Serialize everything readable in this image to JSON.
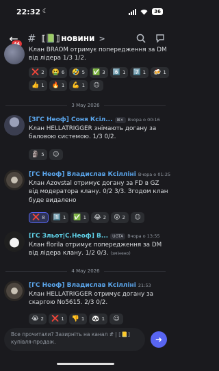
{
  "status": {
    "time": "22:32",
    "battery": "36"
  },
  "header": {
    "badge": "44",
    "hash": "#",
    "channel_prefix": "⟦📗⟧",
    "channel_name": "новини",
    "chevron": ">"
  },
  "messages": [
    {
      "text": "Клан BRAOM отримує попередження за DM від лідера 1/3 1/2.",
      "reactions": [
        {
          "emoji": "❌",
          "count": "2"
        },
        {
          "emoji": "🤮",
          "count": "6"
        },
        {
          "emoji": "🤣",
          "count": "5"
        },
        {
          "emoji": "✅",
          "count": "3"
        },
        {
          "emoji": "6️⃣",
          "count": "1"
        },
        {
          "emoji": "7️⃣",
          "count": "1"
        },
        {
          "emoji": "🍻",
          "count": "1"
        },
        {
          "emoji": "👍",
          "count": "1"
        },
        {
          "emoji": "🔥",
          "count": "1"
        },
        {
          "emoji": "💪",
          "count": "1"
        }
      ]
    },
    {
      "date": "3 May 2026",
      "author": "[ЗГС Неоф] Соня Ксіл...",
      "tag": "⊠✕",
      "time": "Вчора о 00:16",
      "text": "Клан  HELLATRIGGER знімають догану за баловою системою. 1/3 0/2.",
      "reactions": [
        {
          "emoji": "🗿",
          "count": "5"
        }
      ]
    },
    {
      "author": "[ГС Неоф] Владислав Ксілліні",
      "time": "Вчора о 01:25",
      "text": "Клан Azovstal отримує догану за FD в GZ від модератора клану. 0/2 3/3. Згодом клан буде видалено",
      "reactions": [
        {
          "emoji": "❌",
          "count": "8",
          "mine": true
        },
        {
          "emoji": "1️⃣",
          "count": "1"
        },
        {
          "emoji": "✅",
          "count": "1"
        },
        {
          "emoji": "😂",
          "count": "2"
        },
        {
          "emoji": "😵",
          "count": "2"
        }
      ]
    },
    {
      "author": "[ГС Зльот|С.Неоф] В...",
      "tag": "UGTA",
      "time": "Вчора о 13:55",
      "text": "Клан florila отримує попередження за DM від лідера клану. 1/2 0/3.",
      "edited": "(змінено)"
    },
    {
      "date": "4 May 2026",
      "author": "[ГС Неоф] Владислав Ксілліні",
      "time": "21:53",
      "text": "Клан HELLATRIGGER отримує догану за скаргою No5615. 2/3 0/2.",
      "reactions": [
        {
          "emoji": "😭",
          "count": "2"
        },
        {
          "emoji": "❌",
          "count": "1"
        },
        {
          "emoji": "👎",
          "count": "1"
        },
        {
          "emoji": "🐼",
          "count": "1"
        }
      ]
    }
  ],
  "composer": {
    "placeholder": "Все прочитали? Зазирніть на канал # | ⟦📒⟧ купівля-продаж."
  }
}
